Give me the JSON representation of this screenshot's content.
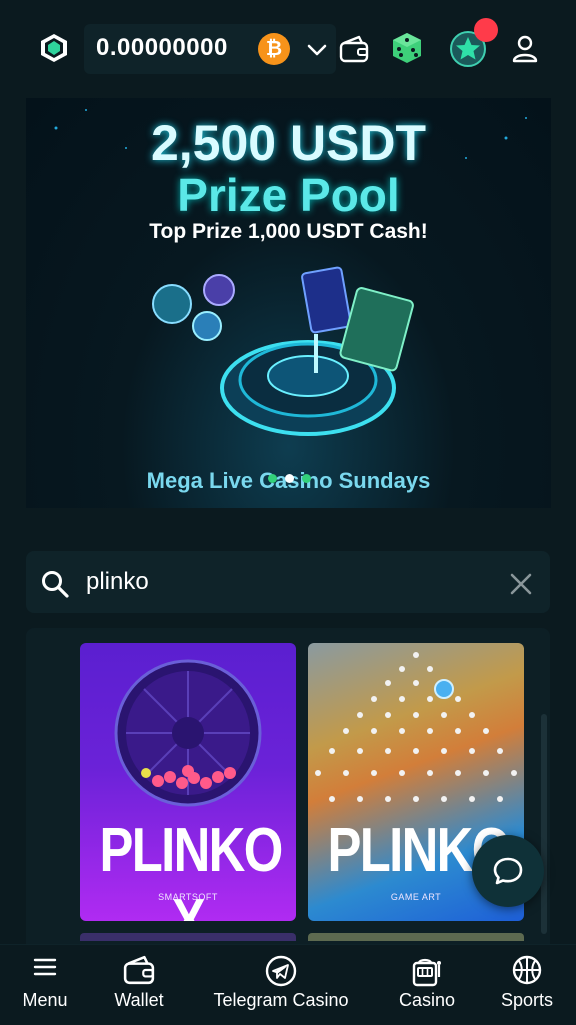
{
  "header": {
    "balance": "0.00000000",
    "currency_symbol": "₿",
    "notification_dot": true
  },
  "banner": {
    "headline": "2,500 USDT",
    "subheadline": "Prize Pool",
    "tagline": "Top Prize 1,000 USDT Cash!",
    "footer": "Mega Live Casino Sundays"
  },
  "search": {
    "value": "plinko"
  },
  "results": [
    {
      "title": "PLINKO X",
      "provider": "SMARTSOFT"
    },
    {
      "title": "PLINKO",
      "provider": "GAME ART"
    }
  ],
  "bottom_nav": {
    "menu": "Menu",
    "wallet": "Wallet",
    "telegram": "Telegram Casino",
    "casino": "Casino",
    "sports": "Sports"
  },
  "colors": {
    "background": "#0b1a1f",
    "panel": "#0f2329",
    "btc": "#f7931a",
    "badge": "#ff3b4a"
  }
}
